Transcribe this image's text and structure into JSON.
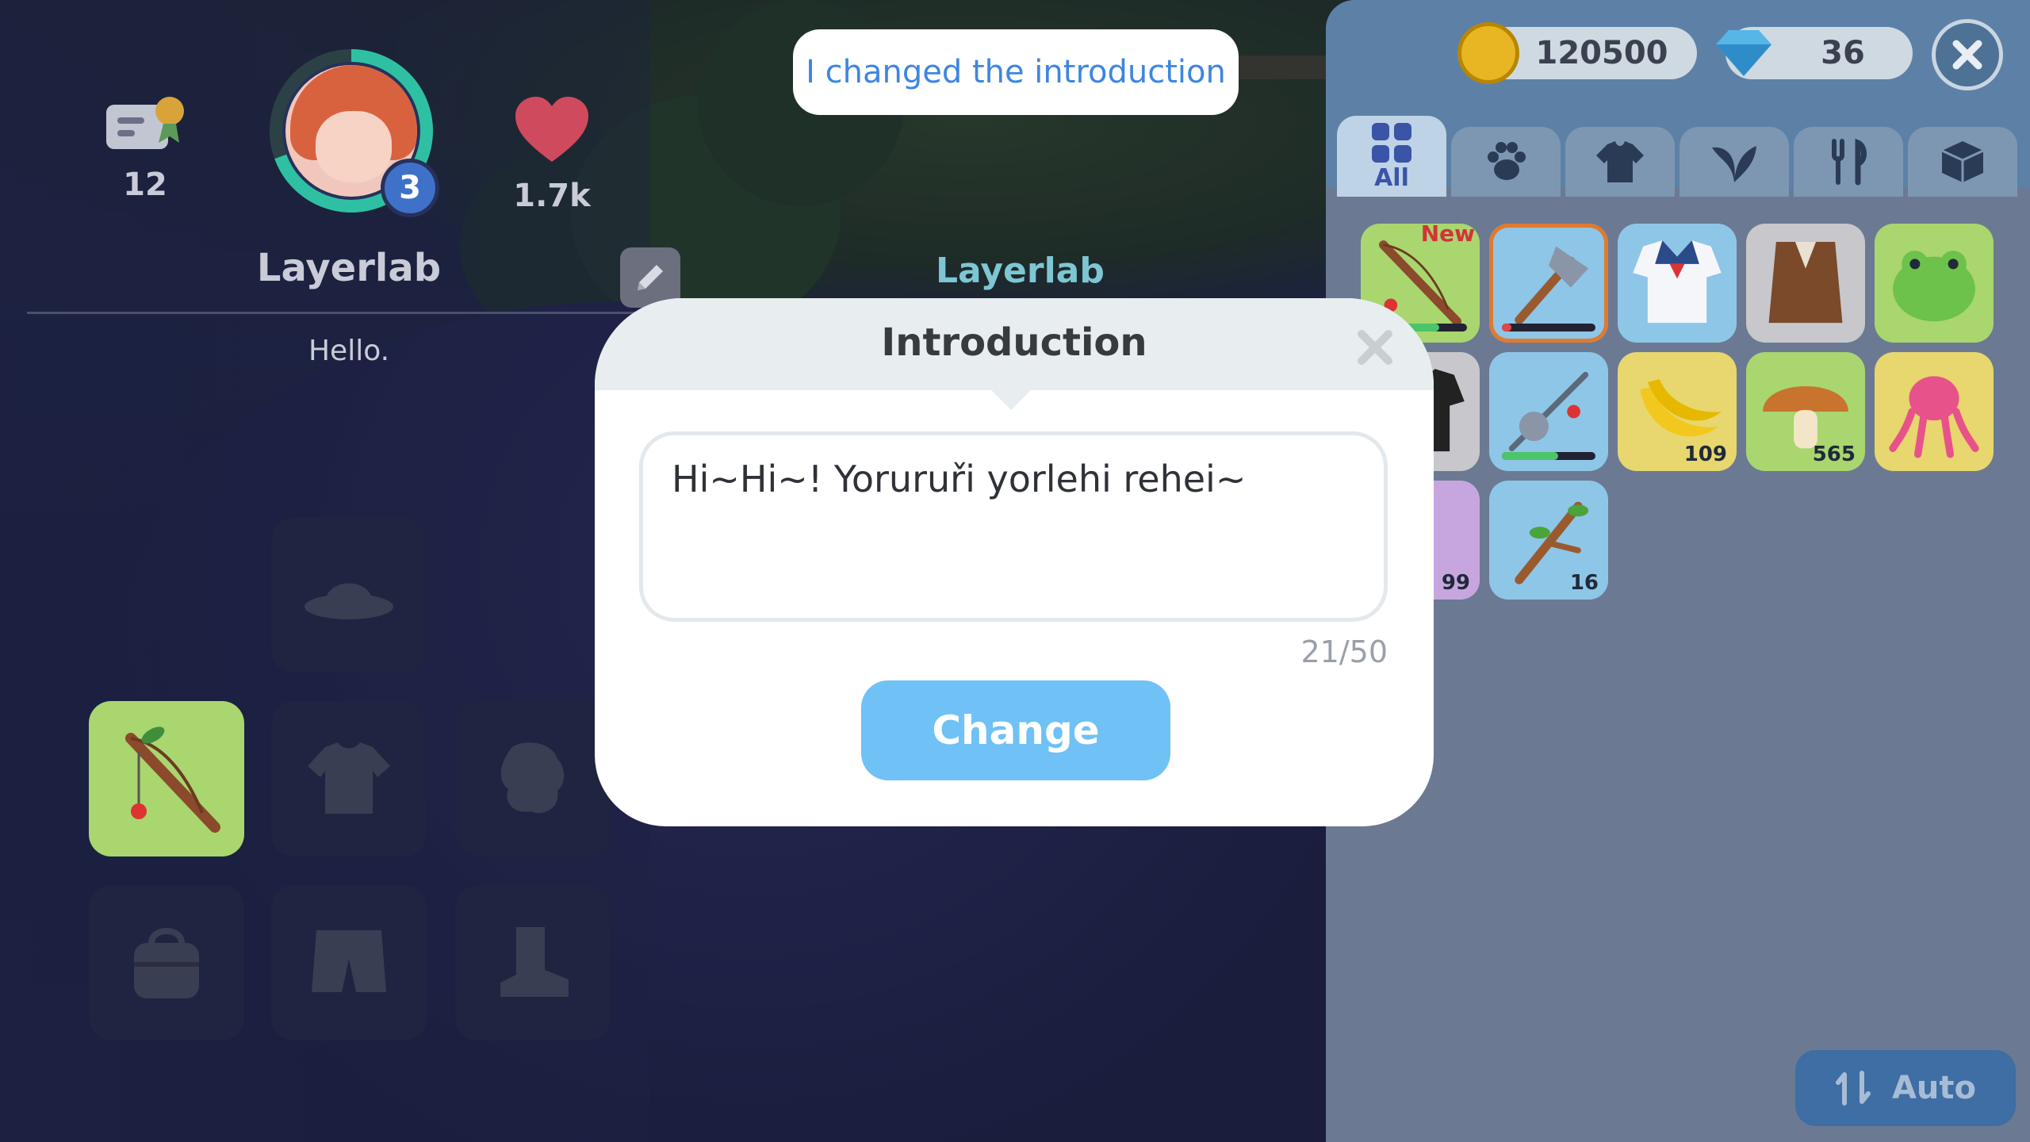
{
  "toast": {
    "message": "I changed the introduction"
  },
  "world": {
    "player_name_tag": "Layerlab"
  },
  "profile": {
    "mail_count": "12",
    "likes": "1.7k",
    "level": "3",
    "name": "Layerlab",
    "introduction": "Hello.",
    "avatar_ring_progress": 0.7
  },
  "equipment_slots": [
    {
      "name": "hat",
      "icon": "hat-icon"
    },
    {
      "name": "fishing-rod",
      "icon": "fishing-rod-icon",
      "active": true
    },
    {
      "name": "top",
      "icon": "shirt-icon"
    },
    {
      "name": "gloves",
      "icon": "glove-icon"
    },
    {
      "name": "bag",
      "icon": "bag-icon"
    },
    {
      "name": "bottom",
      "icon": "shorts-icon"
    },
    {
      "name": "shoes",
      "icon": "boot-icon"
    }
  ],
  "currency": {
    "coins": "120500",
    "gems": "36"
  },
  "inventory": {
    "tabs": [
      {
        "label": "All",
        "icon": "grid-icon",
        "active": true
      },
      {
        "label": "",
        "icon": "paw-icon"
      },
      {
        "label": "",
        "icon": "clothes-icon"
      },
      {
        "label": "",
        "icon": "leaf-icon"
      },
      {
        "label": "",
        "icon": "fork-knife-icon"
      },
      {
        "label": "",
        "icon": "box-icon"
      }
    ],
    "new_label": "New",
    "items": [
      {
        "icon": "fishing-rod-icon",
        "bg": "#a9d66e",
        "new": true,
        "durability": 0.7
      },
      {
        "icon": "axe-icon",
        "bg": "#8ec6e8",
        "durability": 0.1
      },
      {
        "icon": "sailor-shirt-icon",
        "bg": "#8ec6e8"
      },
      {
        "icon": "vest-icon",
        "bg": "#c7c7cc"
      },
      {
        "icon": "frog-hat-icon",
        "bg": "#a9d66e"
      },
      {
        "icon": "black-shirt-icon",
        "bg": "#c7c7cc"
      },
      {
        "icon": "fishing-reel-icon",
        "bg": "#8ec6e8",
        "durability": 0.6
      },
      {
        "icon": "banana-icon",
        "bg": "#e8d66e",
        "count": "109"
      },
      {
        "icon": "mushroom-icon",
        "bg": "#a9d66e",
        "count": "565"
      },
      {
        "icon": "octopus-icon",
        "bg": "#e8d66e"
      },
      {
        "icon": "shell-icon",
        "bg": "#c7a6e0",
        "count": "99"
      },
      {
        "icon": "branch-icon",
        "bg": "#8ec6e8",
        "count": "16"
      }
    ],
    "auto_label": "Auto"
  },
  "modal": {
    "title": "Introduction",
    "input_value": "Hi~Hi~! Yoruruři yorlehi rehei~",
    "counter": "21/50",
    "button_label": "Change"
  },
  "colors": {
    "accent_blue": "#6fc1f6",
    "toast_text": "#3e86e0",
    "panel_blue": "#5d81a6",
    "active_slot": "#a9d66e"
  }
}
